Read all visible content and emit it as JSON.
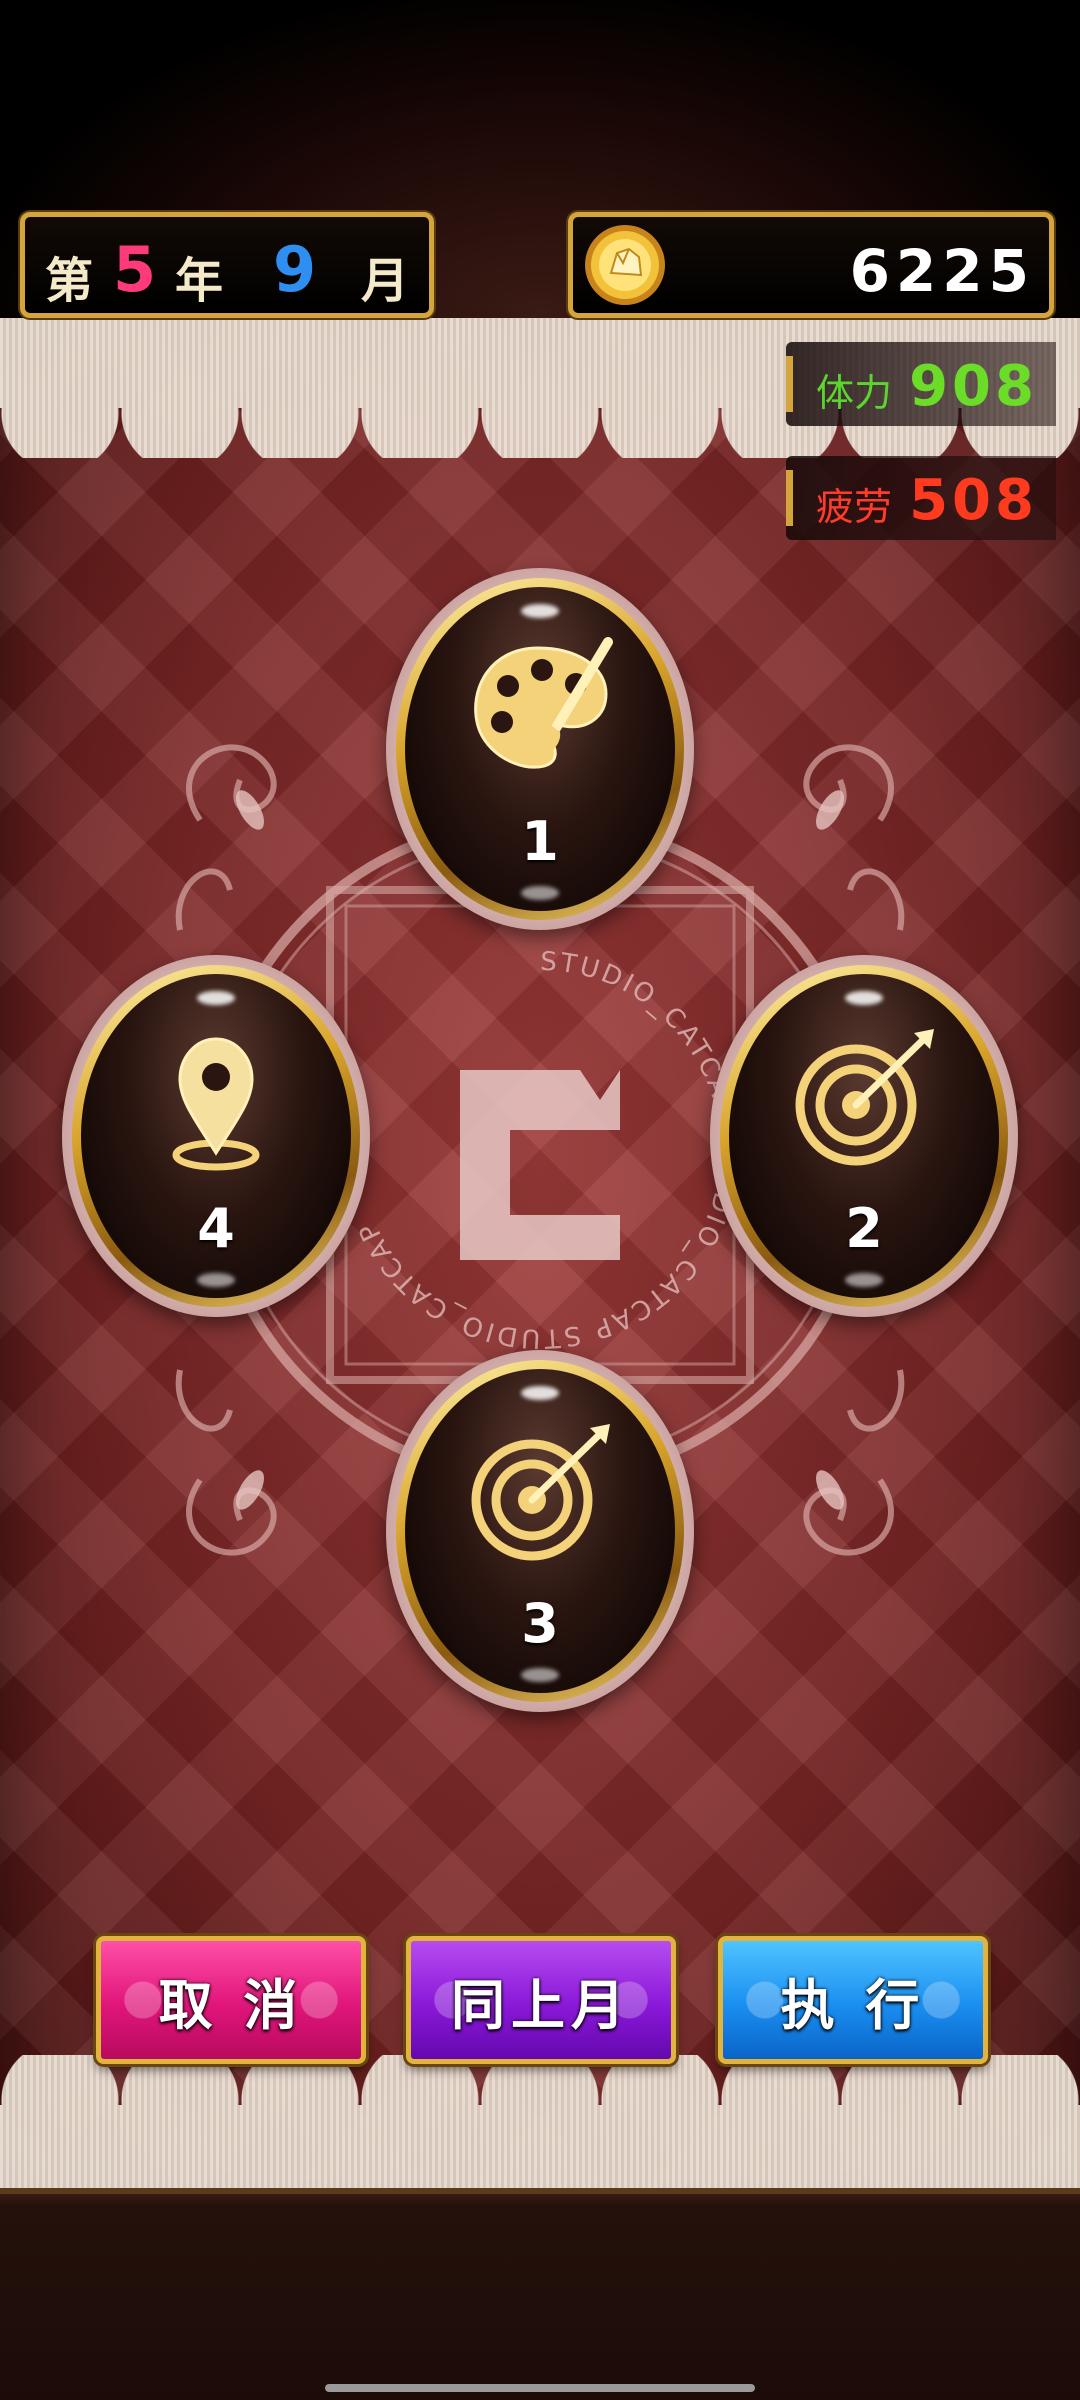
{
  "date": {
    "prefix": "第",
    "year": "5",
    "year_unit": "年",
    "month": "9",
    "month_unit": "月"
  },
  "coins": {
    "icon": "coin-icon",
    "value": "6225"
  },
  "stats": {
    "stamina": {
      "label": "体力",
      "value": "908"
    },
    "fatigue": {
      "label": "疲劳",
      "value": "508"
    }
  },
  "options": [
    {
      "number": "1",
      "icon": "palette-icon"
    },
    {
      "number": "2",
      "icon": "target-icon"
    },
    {
      "number": "3",
      "icon": "target-icon"
    },
    {
      "number": "4",
      "icon": "location-pin-icon"
    }
  ],
  "watermark": {
    "ring_text": "STUDIO_CATCAP STUDIO_CATCAP STUDIO_CATCAP "
  },
  "buttons": {
    "cancel": "取 消",
    "same_as_last_month": "同上月",
    "execute": "执 行"
  },
  "colors": {
    "year": "#ff3a7a",
    "month": "#2e8ff0",
    "stamina": "#6bdc28",
    "fatigue": "#ff3b1f",
    "gold": "#d4a53a",
    "cancel_button": "#e0157a",
    "same_button": "#8a18d8",
    "execute_button": "#1a8ef0"
  }
}
